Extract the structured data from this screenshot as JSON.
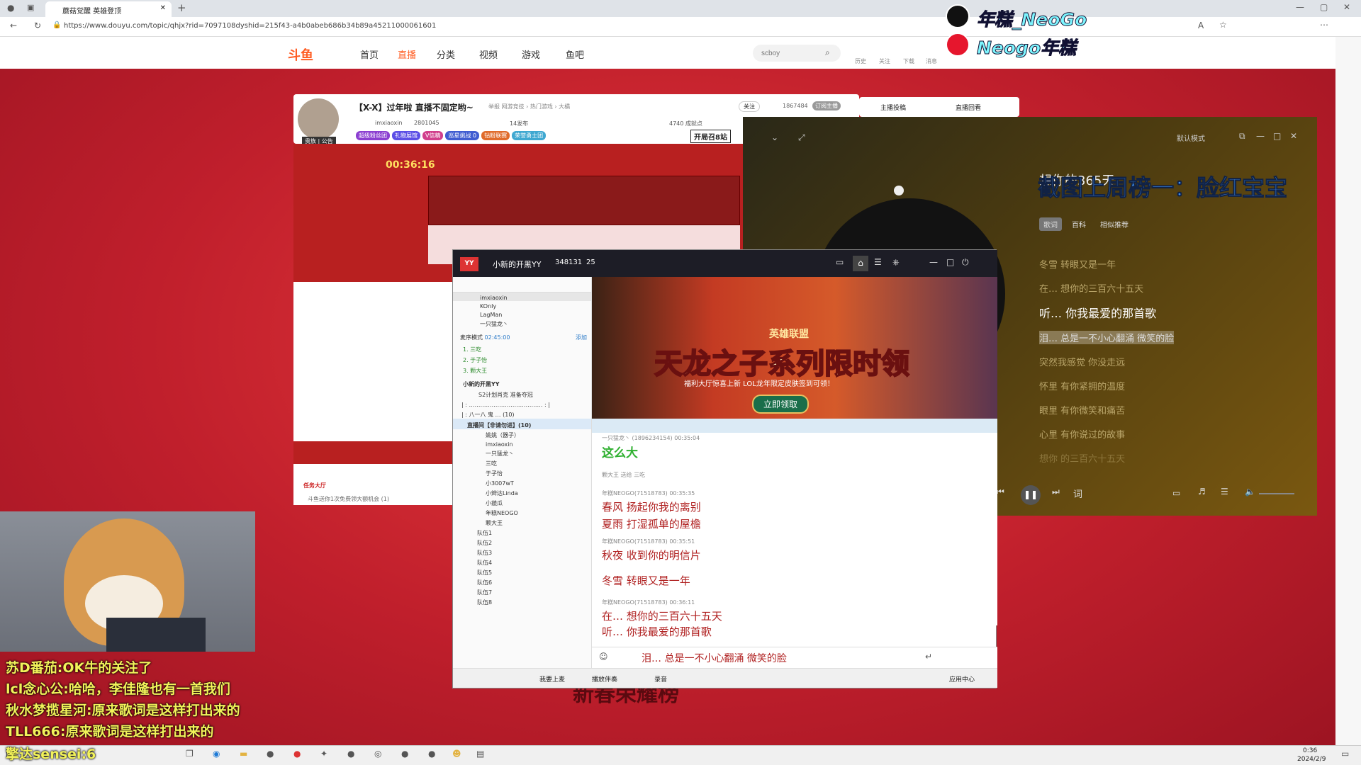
{
  "browser": {
    "tab_title": "蘑菇觉醒 英雄登顶",
    "url": "https://www.douyu.com/topic/qhjx?rid=7097108dyshid=215f43-a4b0abeb686b34b89a45211000061601"
  },
  "overlay": {
    "douyin": "年糕_NeoGo",
    "weibo": "Neogo年糕"
  },
  "site": {
    "logo": "斗鱼",
    "nav": [
      "首页",
      "直播",
      "分类",
      "视频",
      "游戏",
      "鱼吧"
    ],
    "search_placeholder": "scboy",
    "header_icons": [
      "历史",
      "关注",
      "下载",
      "消息"
    ]
  },
  "stream": {
    "title": "【X-X】过年啦 直播不固定哟~",
    "tags": "举报 网游竞技 › 热门游戏 › 大橘",
    "streamer": "imxiaoxin",
    "fans": "2801045",
    "followers": "14发布",
    "hot": "4740 成就点",
    "viewers": "1867484",
    "follow_btn": "关注",
    "subscribe_btn": "订阅主播",
    "rank_tab": "主播投稿",
    "replay_tab": "直播回看",
    "badges": [
      "超级粉丝团",
      "礼物展馆",
      "V信精",
      "巡星挑战 0",
      "钻粉联赛",
      "荣誉勇士团"
    ],
    "promo": "开局召8站",
    "notice": "贵族 | 公告"
  },
  "music": {
    "song": "想你的365天",
    "scroll_banner": "截图上周榜一：脸红宝宝",
    "mode": "默认模式",
    "tabs": [
      "歌词",
      "百科",
      "相似推荐"
    ],
    "lyrics": [
      "冬雪 转眼又是一年",
      "在… 想你的三百六十五天",
      "听… 你我最爱的那首歌",
      "泪… 总是一不小心翻涌 微笑的脸",
      "突然我感觉 你没走远",
      "怀里 有你紧拥的温度",
      "眼里 有你微笑和痛苦",
      "心里 有你说过的故事",
      "想你 的三百六十五天"
    ],
    "ctrl_lyric": "词"
  },
  "yy": {
    "channel": "小新的开黑YY",
    "id": "348131",
    "users": "25",
    "members": [
      "imxiaoxin",
      "KOnIy",
      "LagMan",
      "一只猛龙丶"
    ],
    "mode_label": "麦序模式",
    "time": "02:45:00",
    "host": "添加",
    "queue": [
      "1. 三吃",
      "2. 于子怡",
      "3. 颗大王"
    ],
    "group": "小新的开黑YY",
    "subgroup": "S2计划肖克 准备夺冠",
    "sub_items": [
      "| : ………………………………… : |",
      "| :         八一八         鬼         … (10)"
    ],
    "section": "直播间【非请勿进】(10)",
    "list": [
      "姚姚（器子）",
      "imxiaoxin",
      "一只猛龙丶",
      "三吃",
      "于子怡",
      "小3007wT",
      "小辫达Linda",
      "小藐瓜",
      "年糕NEOGO",
      "颗大王"
    ],
    "teams": [
      "队伍1",
      "队伍2",
      "队伍3",
      "队伍4",
      "队伍5",
      "队伍6",
      "队伍7",
      "队伍8"
    ],
    "banner_brand": "英雄联盟",
    "banner_title": "天龙之子系列限时领",
    "banner_sub": "福利大厅惊喜上新 LOL龙年限定皮肤签到可领！",
    "banner_btn": "立即领取",
    "chat": [
      {
        "meta": "一只猛龙丶 (1896234154) 00:35:04",
        "text": "这么大"
      },
      {
        "meta": "颗大王 送给 三吃",
        "text": ""
      },
      {
        "meta": "年糕NEOGO(71518783) 00:35:35",
        "text": "春风 扬起你我的离别"
      },
      {
        "meta": "",
        "text": "夏雨 打湿孤单的屋檐"
      },
      {
        "meta": "年糕NEOGO(71518783) 00:35:51",
        "text": "秋夜 收到你的明信片"
      },
      {
        "meta": "",
        "text": "冬雪 转眼又是一年"
      },
      {
        "meta": "年糕NEOGO(71518783) 00:36:11",
        "text": "在… 想你的三百六十五天"
      },
      {
        "meta": "",
        "text": "听… 你我最爱的那首歌"
      }
    ],
    "input": "泪… 总是一不小心翻涌 微笑的脸",
    "bottom": [
      "我要上麦",
      "播放伴奏",
      "录音",
      "应用中心"
    ]
  },
  "player": {
    "timer": "00:36:16",
    "task": "任务大厅",
    "gift_notice": "斗鱼送你1次免费领大额机会 (1)",
    "page_title": "新春荣耀榜"
  },
  "danmaku": [
    {
      "name": "苏D番茄",
      "text": "OK牛的关注了"
    },
    {
      "name": "lcl念心公",
      "text": "哈哈，李佳隆也有一首我们"
    },
    {
      "name": "秋水梦揽星河",
      "text": "原来歌词是这样打出来的"
    },
    {
      "name": "TLL666",
      "text": "原来歌词是这样打出来的"
    },
    {
      "name": "擎达sensei",
      "text": "6"
    }
  ],
  "taskbar": {
    "time": "0:36",
    "date": "2024/2/9"
  },
  "colors": {
    "accent": "#ff5d23",
    "lyric_red": "#b02020",
    "danmaku": "#f2f25a"
  }
}
